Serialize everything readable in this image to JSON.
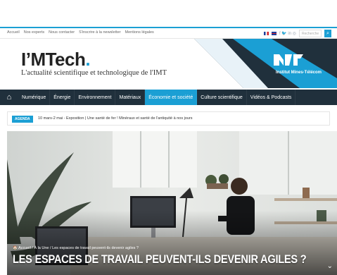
{
  "topbar": {
    "links": [
      "Accueil",
      "Nos experts",
      "Nous contacter",
      "S'inscrire à la newsletter",
      "Mentions légales"
    ],
    "social": "f  🐦  in  ◎",
    "search_placeholder": "Recherche",
    "search_icon": "search-icon"
  },
  "header": {
    "logo_main": "I’MTech",
    "logo_dot": ".",
    "tagline": "L'actualité scientifique et technologique de l'IMT",
    "brand_name": "Institut Mines-Télécom",
    "accent_color": "#1b9fd4",
    "banner_color": "#20303c"
  },
  "nav": {
    "home_icon": "home-icon",
    "items": [
      {
        "label": "Numérique",
        "active": false
      },
      {
        "label": "Énergie",
        "active": false
      },
      {
        "label": "Environnement",
        "active": false
      },
      {
        "label": "Matériaux",
        "active": false
      },
      {
        "label": "Économie et société",
        "active": true
      },
      {
        "label": "Culture scientifique",
        "active": false
      },
      {
        "label": "Vidéos & Podcasts",
        "active": false
      }
    ]
  },
  "agenda": {
    "badge": "AGENDA",
    "text": "10 mars-2 mai - Exposition | Une santé de fer ! Minéraux et santé de l'antiquité à nos jours"
  },
  "hero": {
    "breadcrumb": "🏠 Accueil / À la Une / Les espaces de travail peuvent-ils devenir agiles ?",
    "title": "LES ESPACES DE TRAVAIL PEUVENT-ILS DEVENIR AGILES ?",
    "chevron_icon": "chevron-down-icon"
  }
}
